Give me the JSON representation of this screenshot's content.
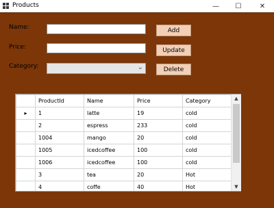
{
  "window": {
    "title": "Products",
    "minimize_glyph": "—",
    "maximize_glyph": "☐",
    "close_glyph": "✕",
    "icon": "grid-app-icon"
  },
  "form": {
    "name_label": "Name:",
    "price_label": "Price:",
    "category_label": "Category:",
    "name_value": "",
    "price_value": "",
    "category_value": "",
    "add_label": "Add",
    "update_label": "Update",
    "delete_label": "Delete"
  },
  "grid": {
    "columns": [
      "ProductId",
      "Name",
      "Price",
      "Category"
    ],
    "current_row_indicator": "▸",
    "rows": [
      [
        "1",
        "latte",
        "19",
        "cold"
      ],
      [
        "2",
        "espress",
        "233",
        "cold"
      ],
      [
        "1004",
        "mango",
        "20",
        "cold"
      ],
      [
        "1005",
        "icedcoffee",
        "100",
        "cold"
      ],
      [
        "1006",
        "icedcoffee",
        "100",
        "cold"
      ],
      [
        "3",
        "tea",
        "20",
        "Hot"
      ],
      [
        "4",
        "coffe",
        "40",
        "Hot"
      ]
    ],
    "scroll_up_glyph": "▲",
    "scroll_down_glyph": "▼"
  },
  "colors": {
    "client_background": "#7c3608",
    "button_background": "#f2cfb6"
  }
}
